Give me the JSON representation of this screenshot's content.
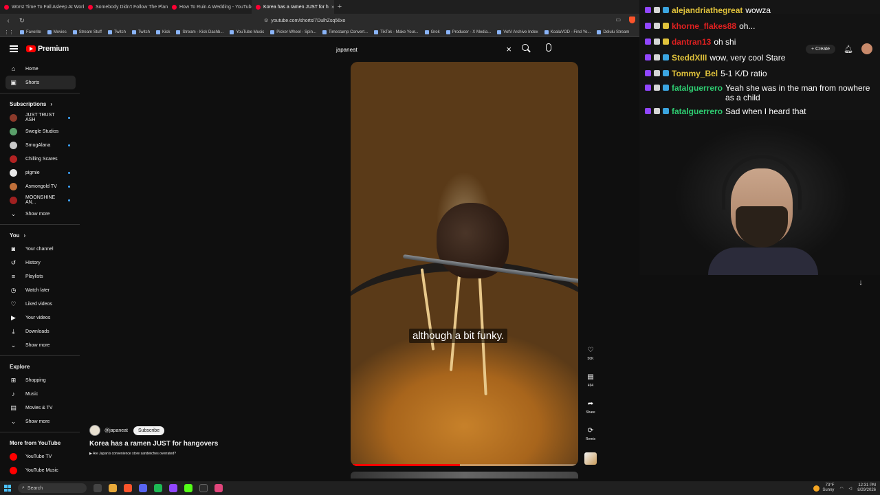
{
  "browser": {
    "tabs": [
      {
        "title": "Worst Time To Fall Asleep At Work -",
        "active": false
      },
      {
        "title": "Somebody Didn't Follow The Plan -",
        "active": false
      },
      {
        "title": "How To Ruin A Wedding - YouTube",
        "active": false
      },
      {
        "title": "Korea has a ramen JUST for h",
        "active": true
      }
    ],
    "url": "youtube.com/shorts/7DulhZsq56xo",
    "bookmarks": [
      "Favorite",
      "Movies",
      "Stream Stuff",
      "Twitch",
      "Twitch",
      "Kick",
      "Stream - Kick Dashb...",
      "YouTube Music",
      "Picker Wheel - Spin...",
      "Timestamp Convert...",
      "TikTok - Make Your...",
      "Grok",
      "Producer - X Media...",
      "VotV Archive Index",
      "KoalaVOD - Find Yo...",
      "Delulu Stream"
    ]
  },
  "youtube": {
    "brand": "Premium",
    "search_value": "japaneat",
    "create_label": "Create",
    "sidebar": {
      "top": [
        {
          "label": "Home",
          "icon": "home-icon",
          "glyph": "⌂"
        },
        {
          "label": "Shorts",
          "icon": "shorts-icon",
          "glyph": "▣",
          "active": true
        }
      ],
      "subscriptions_header": "Subscriptions",
      "subscriptions": [
        {
          "label": "JUST TRUST ASH",
          "color": "#8b3a2a",
          "dot": true
        },
        {
          "label": "Swegle Studios",
          "color": "#5aa06a",
          "dot": false
        },
        {
          "label": "SmugAlana",
          "color": "#c9c9c9",
          "dot": true
        },
        {
          "label": "Chilling Scares",
          "color": "#b22222",
          "dot": false
        },
        {
          "label": "pigmie",
          "color": "#e8e8e8",
          "dot": true
        },
        {
          "label": "Asmongold TV",
          "color": "#c0703a",
          "dot": true
        },
        {
          "label": "MOONSHINE AN...",
          "color": "#a02020",
          "dot": true
        }
      ],
      "show_more": "Show more",
      "you_header": "You",
      "you_items": [
        {
          "label": "Your channel",
          "glyph": "◙"
        },
        {
          "label": "History",
          "glyph": "↺"
        },
        {
          "label": "Playlists",
          "glyph": "≡"
        },
        {
          "label": "Watch later",
          "glyph": "◷"
        },
        {
          "label": "Liked videos",
          "glyph": "♡"
        },
        {
          "label": "Your videos",
          "glyph": "▶"
        },
        {
          "label": "Downloads",
          "glyph": "⤓"
        }
      ],
      "explore_header": "Explore",
      "explore_items": [
        {
          "label": "Shopping",
          "glyph": "⊞"
        },
        {
          "label": "Music",
          "glyph": "♪"
        },
        {
          "label": "Movies & TV",
          "glyph": "▤"
        }
      ],
      "more_header": "More from YouTube",
      "more_items": [
        {
          "label": "YouTube TV",
          "color": "#ff0000"
        },
        {
          "label": "YouTube Music",
          "color": "#ff0000"
        }
      ]
    },
    "short": {
      "caption": "although a bit funky.",
      "progress": 0.48,
      "channel": "@japaneat",
      "subscribe_label": "Subscribe",
      "title": "Korea has a ramen JUST for hangovers",
      "related": "Are Japan's convenience store sandwiches overrated?",
      "actions": [
        {
          "name": "like",
          "glyph": "♡",
          "label": "50K"
        },
        {
          "name": "comments",
          "glyph": "▤",
          "label": "494"
        },
        {
          "name": "share",
          "glyph": "➦",
          "label": "Share"
        },
        {
          "name": "remix",
          "glyph": "⟳",
          "label": "Remix"
        }
      ]
    }
  },
  "chat": [
    {
      "user": "alejandriathegreat",
      "user_color": "#e0c23b",
      "msg": "wowza"
    },
    {
      "user": "khorne_flakes88",
      "user_color": "#e02020",
      "msg": "oh..."
    },
    {
      "user": "dantran13",
      "user_color": "#e02020",
      "msg": "oh shi"
    },
    {
      "user": "SteddXIII",
      "user_color": "#e0c23b",
      "msg": "wow, very cool Stare"
    },
    {
      "user": "Tommy_Bel",
      "user_color": "#e0c23b",
      "msg": "5-1 K/D ratio"
    },
    {
      "user": "fatalguerrero",
      "user_color": "#2ecc71",
      "msg": "Yeah she was in the man from nowhere as a child"
    },
    {
      "user": "fatalguerrero",
      "user_color": "#2ecc71",
      "msg": "Sad when I heard that"
    }
  ],
  "taskbar": {
    "search_label": "Search",
    "weather_temp": "73°F",
    "weather_desc": "Sunny",
    "time": "12:31 PM",
    "date": "8/29/2026"
  }
}
